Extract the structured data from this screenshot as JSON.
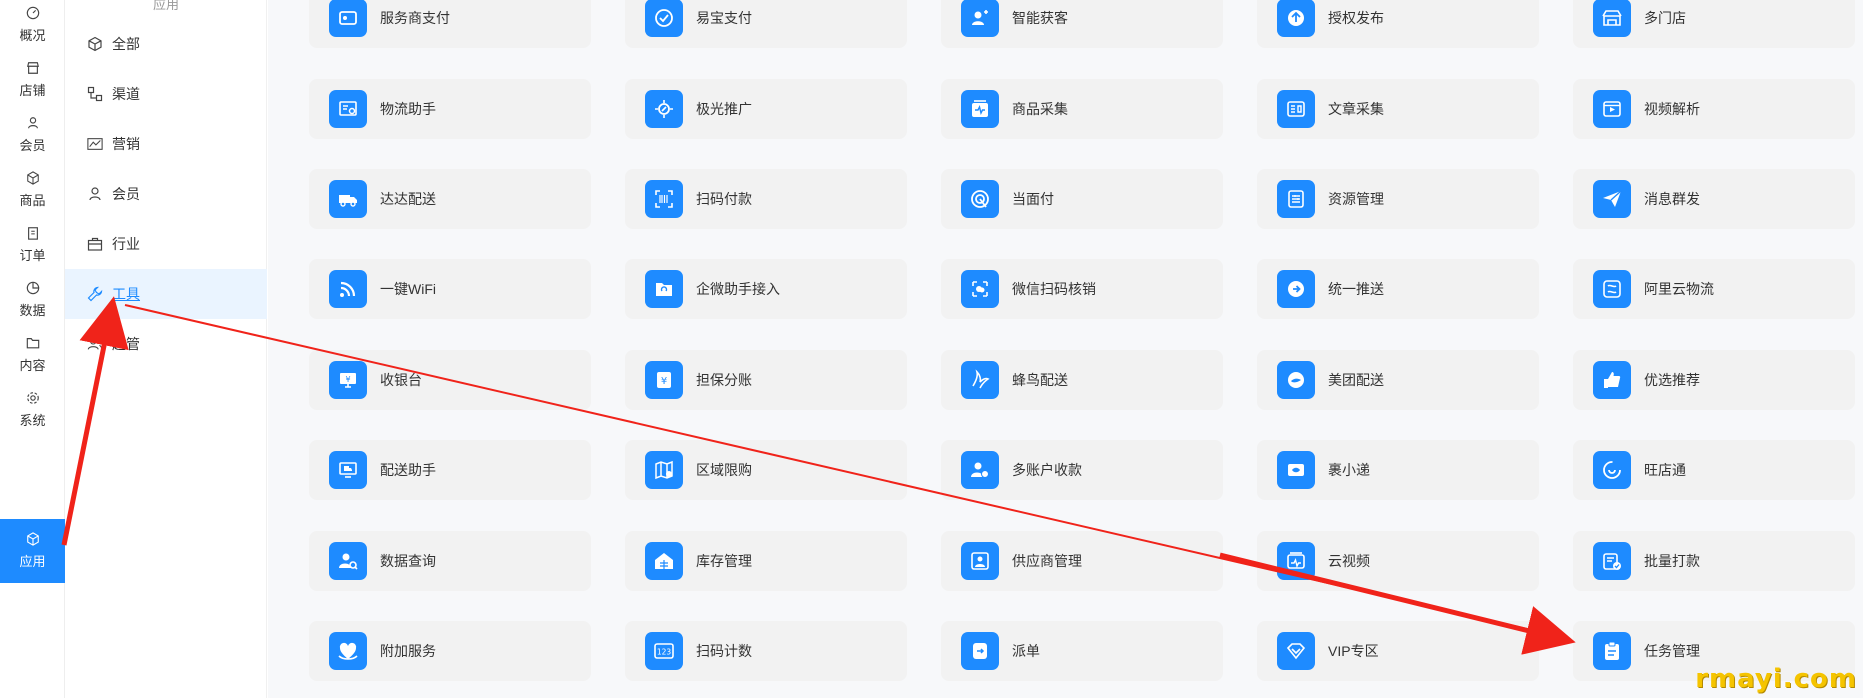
{
  "nav1": {
    "items": [
      {
        "label": "概况",
        "icon": "dashboard-icon"
      },
      {
        "label": "店铺",
        "icon": "store-icon"
      },
      {
        "label": "会员",
        "icon": "user-icon"
      },
      {
        "label": "商品",
        "icon": "box-icon"
      },
      {
        "label": "订单",
        "icon": "clipboard-icon"
      },
      {
        "label": "数据",
        "icon": "pie-icon"
      },
      {
        "label": "内容",
        "icon": "folder-icon"
      },
      {
        "label": "系统",
        "icon": "gear-icon"
      },
      {
        "label": "应用",
        "icon": "cube-icon"
      }
    ]
  },
  "nav2": {
    "head": "应用",
    "items": [
      {
        "label": "全部",
        "icon": "cube-icon"
      },
      {
        "label": "渠道",
        "icon": "channel-icon"
      },
      {
        "label": "营销",
        "icon": "chart-icon"
      },
      {
        "label": "会员",
        "icon": "user-icon"
      },
      {
        "label": "行业",
        "icon": "briefcase-icon"
      },
      {
        "label": "工具",
        "icon": "wrench-icon"
      },
      {
        "label": "超管",
        "icon": "users-icon"
      }
    ]
  },
  "apps": [
    "服务商支付",
    "易宝支付",
    "智能获客",
    "授权发布",
    "多门店",
    "物流助手",
    "极光推广",
    "商品采集",
    "文章采集",
    "视频解析",
    "达达配送",
    "扫码付款",
    "当面付",
    "资源管理",
    "消息群发",
    "一键WiFi",
    "企微助手接入",
    "微信扫码核销",
    "统一推送",
    "阿里云物流",
    "收银台",
    "担保分账",
    "蜂鸟配送",
    "美团配送",
    "优选推荐",
    "配送助手",
    "区域限购",
    "多账户收款",
    "裹小递",
    "旺店通",
    "数据查询",
    "库存管理",
    "供应商管理",
    "云视频",
    "批量打款",
    "附加服务",
    "扫码计数",
    "派单",
    "VIP专区",
    "任务管理"
  ],
  "colors": {
    "accent": "#1e8bff",
    "arrow": "#f0231a",
    "watermark": "#f5c400"
  },
  "watermark": "rmayi.com"
}
